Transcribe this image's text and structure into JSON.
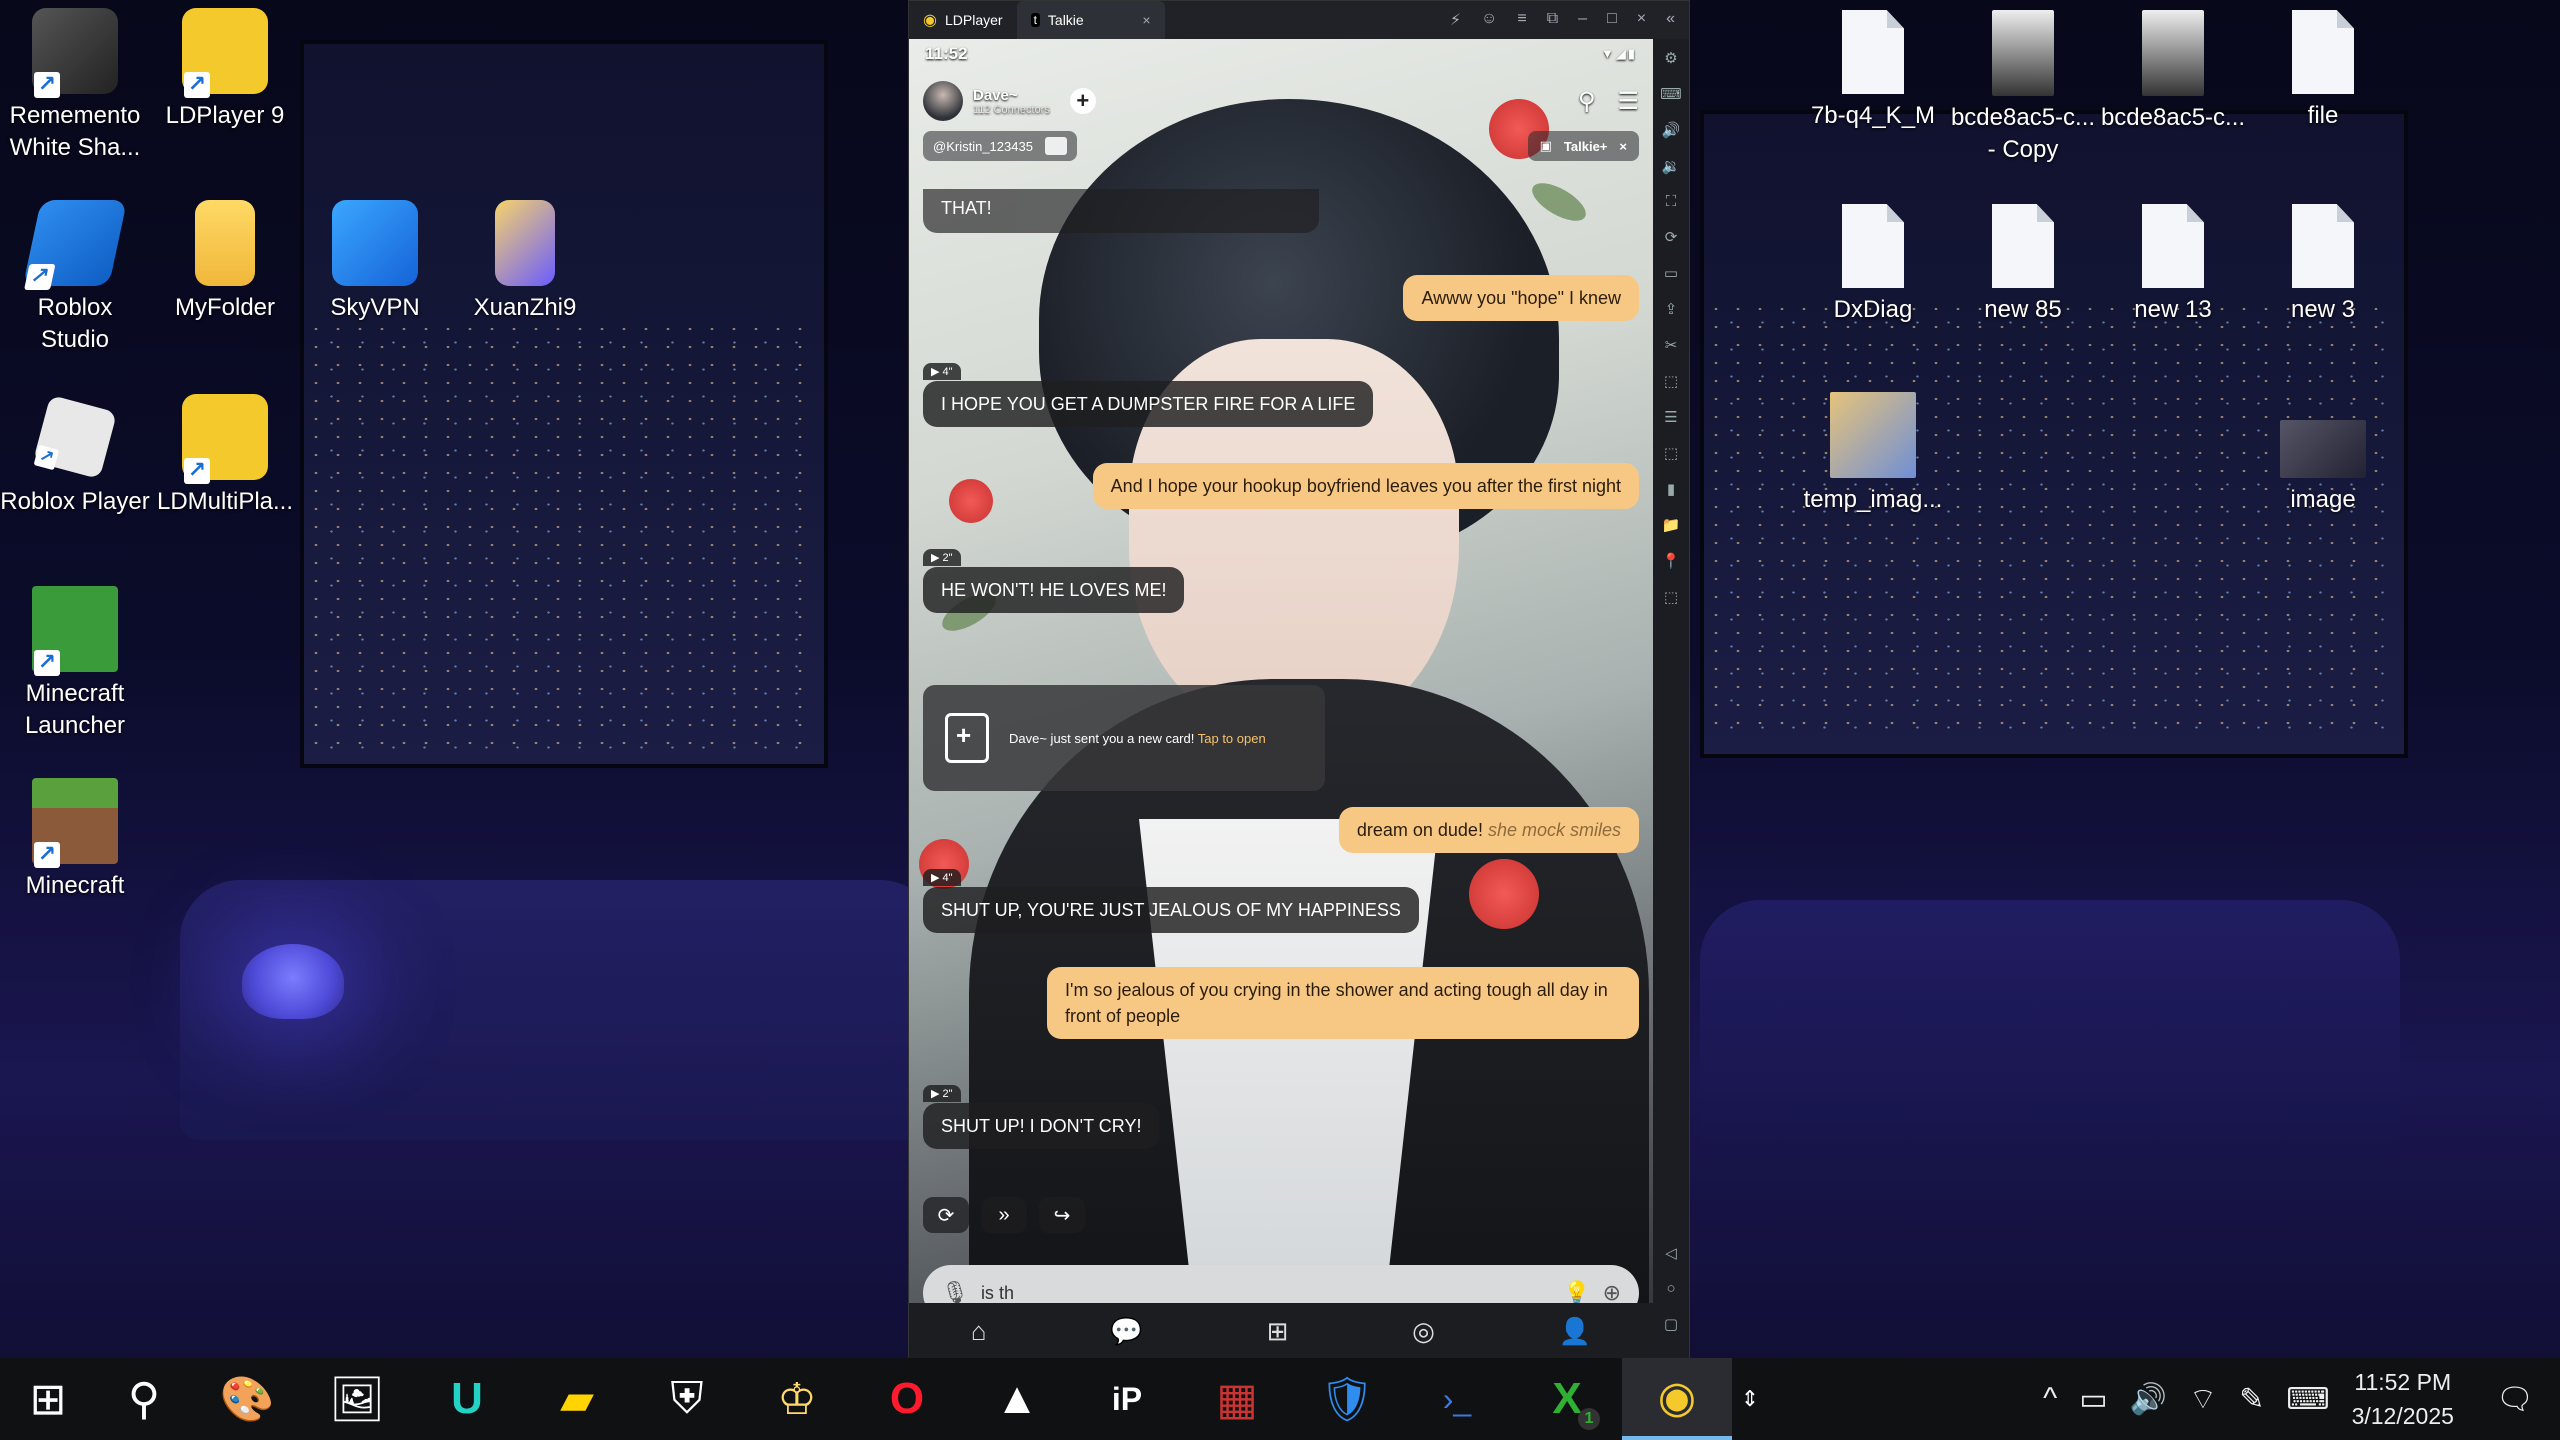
{
  "desktop": {
    "left_icons": [
      {
        "label": "Rememento\nWhite Sha...",
        "icon": "rememento-icon"
      },
      {
        "label": "LDPlayer 9",
        "icon": "ldplayer-icon"
      },
      {
        "label": "Roblox\nStudio",
        "icon": "roblox-studio-icon"
      },
      {
        "label": "MyFolder",
        "icon": "folder-icon"
      },
      {
        "label": "SkyVPN",
        "icon": "skyvpn-icon"
      },
      {
        "label": "XuanZhi9",
        "icon": "xuanzhi-icon"
      },
      {
        "label": "Roblox Player",
        "icon": "roblox-player-icon"
      },
      {
        "label": "LDMultiPla...",
        "icon": "ldmultiplayer-icon"
      },
      {
        "label": "Minecraft\nLauncher",
        "icon": "minecraft-launcher-icon"
      },
      {
        "label": "Minecraft",
        "icon": "minecraft-icon"
      }
    ],
    "right_icons": [
      {
        "label": "7b-q4_K_M",
        "icon": "file-icon"
      },
      {
        "label": "bcde8ac5-c...\n- Copy",
        "icon": "image-file-icon"
      },
      {
        "label": "bcde8ac5-c...",
        "icon": "image-file-icon"
      },
      {
        "label": "file",
        "icon": "file-icon"
      },
      {
        "label": "DxDiag",
        "icon": "file-icon"
      },
      {
        "label": "new 85",
        "icon": "file-icon"
      },
      {
        "label": "new 13",
        "icon": "file-icon"
      },
      {
        "label": "new 3",
        "icon": "file-icon"
      },
      {
        "label": "temp_imag...",
        "icon": "image-file-icon"
      },
      {
        "label": "image",
        "icon": "image-file-icon"
      }
    ]
  },
  "emulator": {
    "tabs": [
      "LDPlayer",
      "Talkie"
    ],
    "close_tab": "×",
    "controls": [
      "⚡",
      "☺",
      "≡",
      "⧉",
      "–",
      "□",
      "×",
      "«"
    ],
    "sidebar_icons": [
      "⚙",
      "⌨",
      "🔊",
      "🔉",
      "⛶",
      "⟳",
      "▭",
      "⇪",
      "✂",
      "⬚",
      "☰",
      "⬚",
      "▮",
      "📁",
      "📍",
      "⬚",
      "◁",
      "○",
      "▢"
    ],
    "status": {
      "time": "11:52",
      "icons": "▼◢▮"
    },
    "header": {
      "name": "Dave~",
      "sub": "112 Connectors",
      "add": "+"
    },
    "user_chip": "@Kristin_123435",
    "talkie_plus": "Talkie+",
    "talkie_close": "×",
    "partial_top": "THAT!",
    "messages": [
      {
        "from": "me",
        "text": "Awww you \"hope\" I knew"
      },
      {
        "from": "bot",
        "voice": "▶ 4\"",
        "text": "I HOPE YOU GET A DUMPSTER FIRE FOR A LIFE"
      },
      {
        "from": "me",
        "text": "And I hope your hookup boyfriend leaves you after the first night"
      },
      {
        "from": "bot",
        "voice": "▶ 2\"",
        "text": "HE WON'T! HE LOVES ME!"
      },
      {
        "from": "me",
        "text": "dream on dude!",
        "action": "she mock smiles"
      },
      {
        "from": "bot",
        "voice": "▶ 4\"",
        "text": "SHUT UP, YOU'RE JUST JEALOUS OF MY HAPPINESS"
      },
      {
        "from": "me",
        "text": "I'm so jealous of you crying in the shower and acting tough all day in front of people"
      },
      {
        "from": "bot",
        "voice": "▶ 2\"",
        "text": "SHUT UP! I DON'T CRY!"
      }
    ],
    "card": {
      "text": "Dave~ just sent you a new card!",
      "tap": "Tap to open"
    },
    "actions": [
      "⟳",
      "»",
      "↪"
    ],
    "input_value": "is th",
    "input_icons": {
      "mic": "🎙",
      "hint": "💡",
      "plus": "⊕"
    },
    "nav": [
      "⌂",
      "💬",
      "⊞",
      "◎",
      "👤"
    ]
  },
  "taskbar": {
    "apps": [
      "⊞",
      "⚲",
      "🎨",
      "🖼",
      "U",
      "▰",
      "⛨",
      "♔",
      "O",
      "▲",
      "iP",
      "▦",
      "🛡",
      "›_",
      "X",
      "◉"
    ],
    "tray_up": "^",
    "tray_badge": "1",
    "time": "11:52 PM",
    "date": "3/12/2025"
  },
  "colors": {
    "accent_me": "#f7c884",
    "bot_bubble": "#1e1e20",
    "tap": "#f5c36c"
  }
}
